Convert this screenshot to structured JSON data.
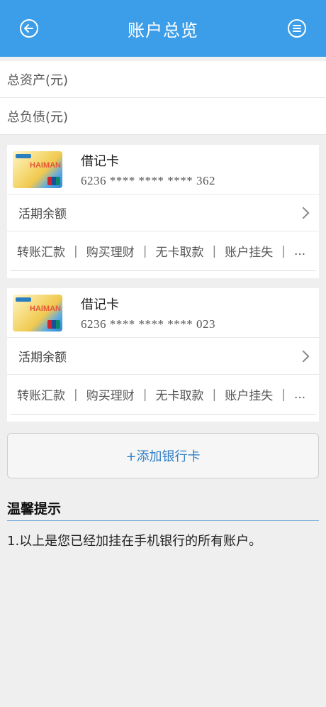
{
  "header": {
    "title": "账户总览"
  },
  "summary": {
    "total_assets": "总资产(元)",
    "total_liabilities": "总负债(元)"
  },
  "cards": [
    {
      "type": "借记卡",
      "number": "6236 **** **** **** 362",
      "balance_label": "活期余额",
      "actions": [
        "转账汇款",
        "购买理财",
        "无卡取款",
        "账户挂失",
        "..."
      ]
    },
    {
      "type": "借记卡",
      "number": "6236 **** **** **** 023",
      "balance_label": "活期余额",
      "actions": [
        "转账汇款",
        "购买理财",
        "无卡取款",
        "账户挂失",
        "..."
      ]
    }
  ],
  "add_card": {
    "label": "+添加银行卡"
  },
  "tips": {
    "title": "温馨提示",
    "items": [
      "1.以上是您已经加挂在手机银行的所有账户。"
    ]
  },
  "card_image": {
    "brand": "HAIMAN"
  },
  "colors": {
    "accent": "#3c9ee8",
    "link": "#2e7fc7"
  }
}
